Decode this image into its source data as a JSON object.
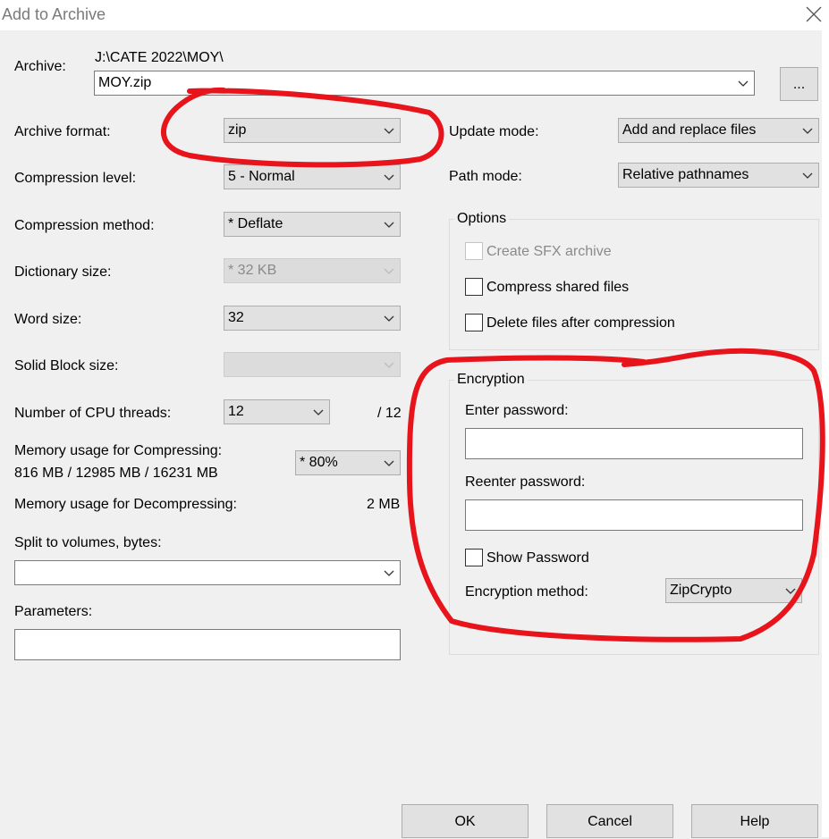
{
  "window": {
    "title": "Add to Archive"
  },
  "archive": {
    "label": "Archive:",
    "path": "J:\\CATE 2022\\MOY\\",
    "filename": "MOY.zip",
    "browse_label": "..."
  },
  "left": {
    "format": {
      "label": "Archive format:",
      "value": "zip"
    },
    "level": {
      "label": "Compression level:",
      "value": "5 - Normal"
    },
    "method": {
      "label": "Compression method:",
      "value": "*  Deflate"
    },
    "dict": {
      "label": "Dictionary size:",
      "value": "*  32 KB"
    },
    "word": {
      "label": "Word size:",
      "value": "32"
    },
    "solid": {
      "label": "Solid Block size:",
      "value": ""
    },
    "threads": {
      "label": "Number of CPU threads:",
      "value": "12",
      "max": "/ 12"
    },
    "mem_comp": {
      "label": "Memory usage for Compressing:",
      "detail": "816 MB / 12985 MB / 16231 MB",
      "value": "* 80%"
    },
    "mem_decomp": {
      "label": "Memory usage for Decompressing:",
      "value": "2 MB"
    },
    "split": {
      "label": "Split to volumes, bytes:",
      "value": ""
    },
    "params": {
      "label": "Parameters:",
      "value": ""
    }
  },
  "right": {
    "update": {
      "label": "Update mode:",
      "value": "Add and replace files"
    },
    "pathmode": {
      "label": "Path mode:",
      "value": "Relative pathnames"
    },
    "options": {
      "title": "Options",
      "sfx": "Create SFX archive",
      "shared": "Compress shared files",
      "delete": "Delete files after compression"
    },
    "encryption": {
      "title": "Encryption",
      "enter_label": "Enter password:",
      "reenter_label": "Reenter password:",
      "show_label": "Show Password",
      "method_label": "Encryption method:",
      "method_value": "ZipCrypto"
    }
  },
  "buttons": {
    "ok": "OK",
    "cancel": "Cancel",
    "help": "Help"
  },
  "colors": {
    "annotation": "#e8141b",
    "background": "#f0f0f0",
    "disabled_text": "#8a8a8a"
  }
}
